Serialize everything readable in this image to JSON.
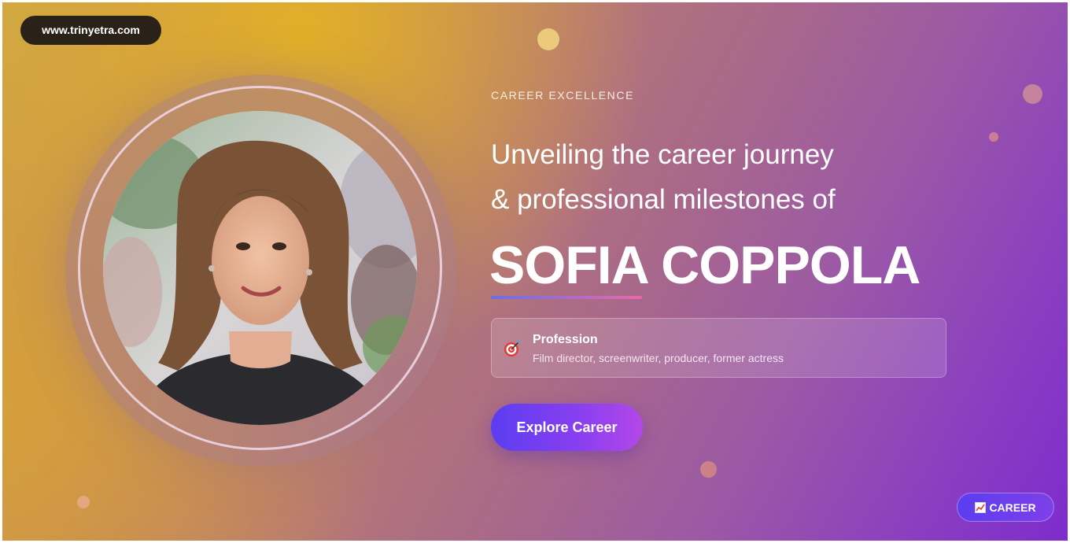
{
  "site": {
    "url_label": "www.trinyetra.com"
  },
  "hero": {
    "eyebrow": "CAREER EXCELLENCE",
    "headline_line1": "Unveiling the career journey",
    "headline_line2": "& professional milestones of",
    "name": "SOFIA COPPOLA"
  },
  "profession": {
    "icon": "target-icon",
    "title": "Profession",
    "value": "Film director, screenwriter, producer, former actress"
  },
  "cta": {
    "label": "Explore Career"
  },
  "badge": {
    "icon": "chart-icon",
    "label": "CAREER"
  },
  "colors": {
    "accent_start": "#5b3df0",
    "accent_end": "#b448e8",
    "pill_bg": "#2a2118",
    "text": "#ffffff"
  }
}
